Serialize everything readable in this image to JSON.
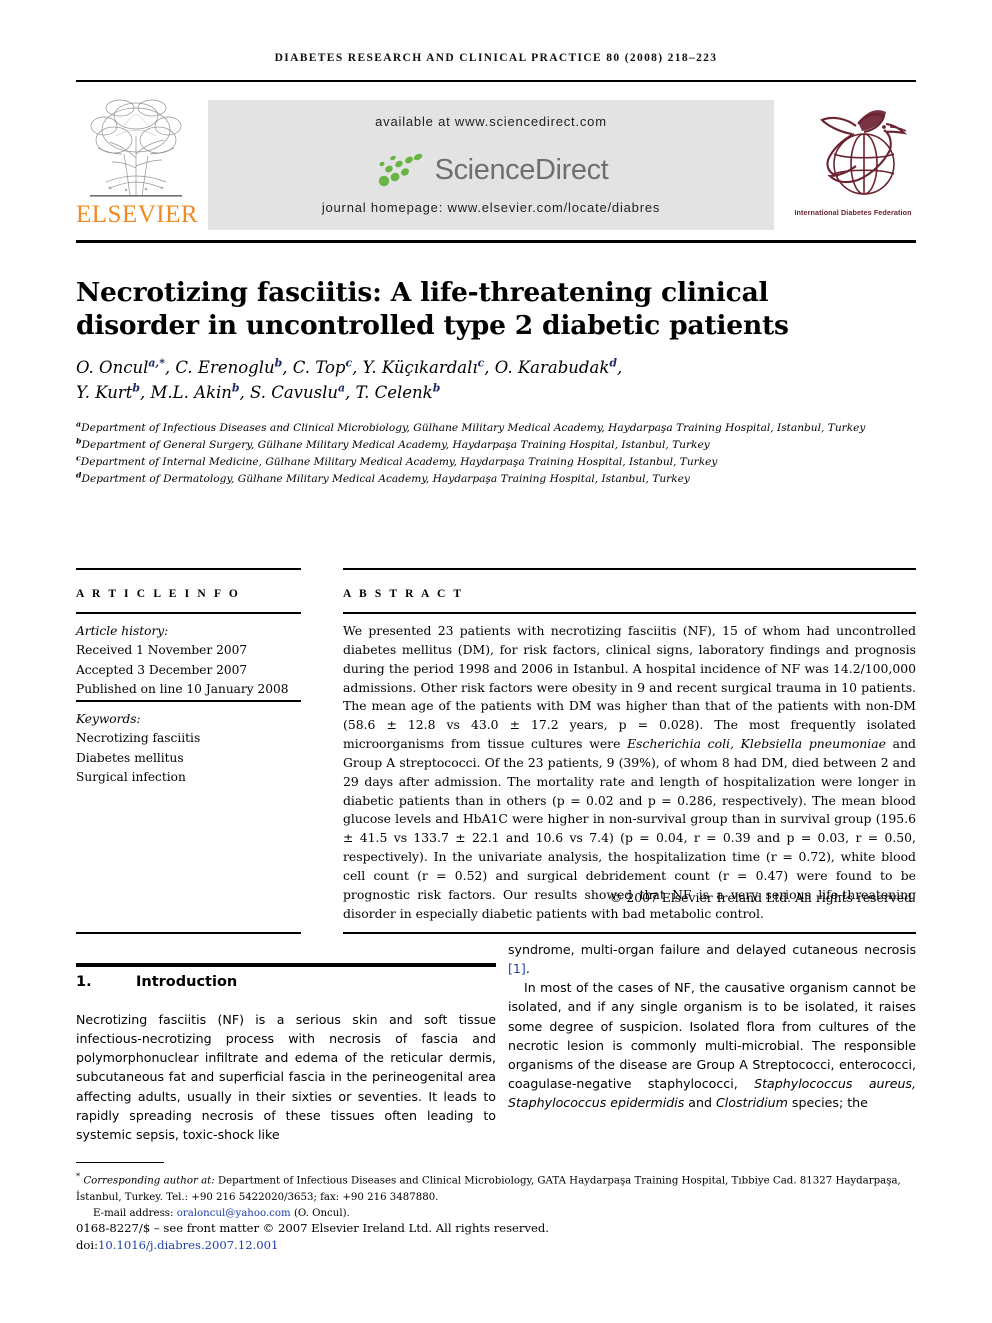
{
  "running_head": "DIABETES RESEARCH AND CLINICAL PRACTICE 80 (2008) 218–223",
  "banner": {
    "publisher_name": "ELSEVIER",
    "publisher_logo_alt": "elsevier-tree-logo",
    "available_at": "available at www.sciencedirect.com",
    "sciencedirect_wordmark": "ScienceDirect",
    "journal_homepage": "journal homepage: www.elsevier.com/locate/diabres",
    "society_caption": "International Diabetes Federation",
    "society_logo_alt": "idf-bird-globe-logo"
  },
  "article": {
    "title": "Necrotizing fasciitis: A life-threatening clinical disorder in uncontrolled type 2 diabetic patients",
    "authors_line_1": "O. Oncul",
    "authors": [
      {
        "name": "O. Oncul",
        "marks": "a,*"
      },
      {
        "name": "C. Erenoglu",
        "marks": "b"
      },
      {
        "name": "C. Top",
        "marks": "c"
      },
      {
        "name": "Y. Küçıkardalı",
        "marks": "c"
      },
      {
        "name": "O. Karabudak",
        "marks": "d"
      },
      {
        "name": "Y. Kurt",
        "marks": "b"
      },
      {
        "name": "M.L. Akin",
        "marks": "b"
      },
      {
        "name": "S. Cavuslu",
        "marks": "a"
      },
      {
        "name": "T. Celenk",
        "marks": "b"
      }
    ],
    "affiliations": [
      {
        "mark": "a",
        "text": "Department of Infectious Diseases and Clinical Microbiology, Gülhane Military Medical Academy, Haydarpaşa Training Hospital, Istanbul, Turkey"
      },
      {
        "mark": "b",
        "text": "Department of General Surgery, Gülhane Military Medical Academy, Haydarpaşa Training Hospital, Istanbul, Turkey"
      },
      {
        "mark": "c",
        "text": "Department of Internal Medicine, Gülhane Military Medical Academy, Haydarpaşa Training Hospital, Istanbul, Turkey"
      },
      {
        "mark": "d",
        "text": "Department of Dermatology, Gülhane Military Medical Academy, Haydarpaşa Training Hospital, Istanbul, Turkey"
      }
    ]
  },
  "article_info": {
    "heading": "A R T I C L E   I N F O",
    "history_label": "Article history:",
    "history": [
      "Received 1 November 2007",
      "Accepted 3 December 2007",
      "Published on line 10 January 2008"
    ],
    "keywords_label": "Keywords:",
    "keywords": [
      "Necrotizing fasciitis",
      "Diabetes mellitus",
      "Surgical infection"
    ]
  },
  "abstract": {
    "heading": "A B S T R A C T",
    "text_part_1": "We presented 23 patients with necrotizing fasciitis (NF), 15 of whom had uncontrolled diabetes mellitus (DM), for risk factors, clinical signs, laboratory findings and prognosis during the period 1998 and 2006 in Istanbul. A hospital incidence of NF was 14.2/100,000 admissions. Other risk factors were obesity in 9 and recent surgical trauma in 10 patients. The mean age of the patients with DM was higher than that of the patients with non-DM (58.6 ± 12.8 vs 43.0 ± 17.2 years, p = 0.028). The most frequently isolated microorganisms from tissue cultures were ",
    "italic_1": "Escherichia coli, Klebsiella pneumoniae",
    "text_part_2": " and Group A streptococci. Of the 23 patients, 9 (39%), of whom 8 had DM, died between 2 and 29 days after admission. The mortality rate and length of hospitalization were longer in diabetic patients than in others (p = 0.02 and p = 0.286, respectively). The mean blood glucose levels and HbA1C were higher in non-survival group than in survival group (195.6 ± 41.5 vs 133.7 ± 22.1 and 10.6 vs 7.4) (p = 0.04, r = 0.39 and p = 0.03, r = 0.50, respectively). In the univariate analysis, the hospitalization time (r = 0.72), white blood cell count (r = 0.52) and surgical debridement count (r = 0.47) were found to be prognostic risk factors. Our results showed that NF is a very serious life-threatening disorder in especially diabetic patients with bad metabolic control.",
    "copyright": "© 2007 Elsevier Ireland Ltd. All rights reserved."
  },
  "body": {
    "section_number": "1.",
    "section_title": "Introduction",
    "left_column": "Necrotizing fasciitis (NF) is a serious skin and soft tissue infectious-necrotizing process with necrosis of fascia and polymorphonuclear infiltrate and edema of the reticular dermis, subcutaneous fat and superficial fascia in the perineogenital area affecting adults, usually in their sixties or seventies. It leads to rapidly spreading necrosis of these tissues often leading to systemic sepsis, toxic-shock like",
    "right_continuation": "syndrome, multi-organ failure and delayed cutaneous necrosis ",
    "right_ref": "[1]",
    "right_after_ref": ".",
    "right_paragraph_2_a": "In most of the cases of NF, the causative organism cannot be isolated, and if any single organism is to be isolated, it raises some degree of suspicion. Isolated flora from cultures of the necrotic lesion is commonly multi-microbial. The responsible organisms of the disease are Group A Streptococci, enterococci, coagulase-negative staphylococci, ",
    "right_italic_1": "Staphylococcus aureus, Staphylococcus epidermidis",
    "right_paragraph_2_b": " and ",
    "right_italic_2": "Clostridium",
    "right_paragraph_2_c": " species; the"
  },
  "footer": {
    "corresponding_marker": "*",
    "corresponding_label": "Corresponding author at:",
    "corresponding_text": " Department of Infectious Diseases and Clinical Microbiology, GATA Haydarpaşa Training Hospital, Tıbbiye Cad. 81327 Haydarpaşa, İstanbul, Turkey. Tel.: +90 216 5422020/3653; fax: +90 216 3487880.",
    "email_label": "E-mail address:",
    "email": "oraloncul@yahoo.com",
    "email_owner": "(O. Oncul).",
    "imprint": "0168-8227/$ – see front matter © 2007 Elsevier Ireland Ltd. All rights reserved.",
    "doi_label": "doi:",
    "doi": "10.1016/j.diabres.2007.12.001"
  },
  "colors": {
    "elsevier_orange": "#f08a22",
    "sciencedirect_green": "#69b444",
    "sciencedirect_gray": "#6f6f6f",
    "idf_maroon": "#6b2330",
    "link_blue": "#1f3fa8",
    "banner_gray": "#e3e3e3"
  }
}
